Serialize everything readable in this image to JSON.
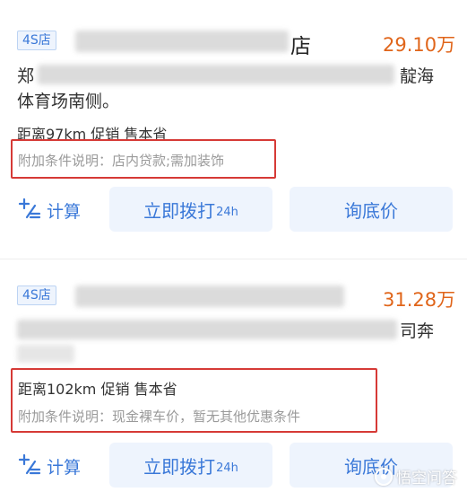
{
  "listings": [
    {
      "badge": "4S店",
      "dealer_visible_tail": "店",
      "price": "29.10万",
      "address_line1_start": "郑",
      "address_line1_end": "靛海",
      "address_line2": "体育场南侧。",
      "meta": "距离97km  促销  售本省",
      "condition": "附加条件说明：店内贷款;需加装饰",
      "calc_label": "计算",
      "dial_label": "立即拨打",
      "dial_sub": "24h",
      "inquiry_label": "询底价"
    },
    {
      "badge": "4S店",
      "dealer_visible_tail": "",
      "price": "31.28万",
      "address_line1_start": "",
      "address_line1_end": "司奔",
      "address_line2": "",
      "meta": "距离102km  促销  售本省",
      "condition": "附加条件说明：现金裸车价，暂无其他优惠条件",
      "calc_label": "计算",
      "dial_label": "立即拨打",
      "dial_sub": "24h",
      "inquiry_label": "询底价"
    }
  ],
  "watermark": "悟空问答",
  "colors": {
    "accent": "#3a78d8",
    "price": "#e0651a",
    "highlight_box": "#d63a36",
    "button_bg": "#eef4fd"
  }
}
